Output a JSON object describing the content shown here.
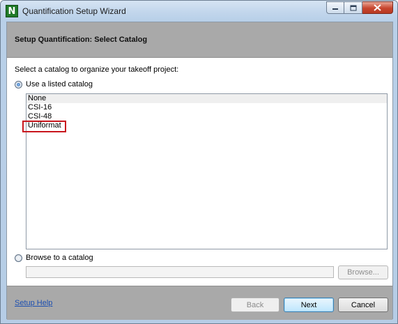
{
  "window": {
    "title": "Quantification Setup Wizard",
    "app_icon_letter": "N"
  },
  "header": {
    "title": "Setup Quantification: Select Catalog"
  },
  "body": {
    "prompt": "Select a catalog to organize your takeoff project:",
    "option_listed": "Use a listed catalog",
    "option_browse": "Browse to a catalog",
    "selected_option": "listed",
    "catalogs": [
      "None",
      "CSI-16",
      "CSI-48",
      "Uniformat"
    ],
    "highlighted_catalog": "Uniformat",
    "browse_value": "",
    "browse_button": "Browse..."
  },
  "footer": {
    "help_link": "Setup Help",
    "back": "Back",
    "next": "Next",
    "cancel": "Cancel"
  },
  "colors": {
    "header_band": "#a9a9a9",
    "highlight_border": "#c8161d",
    "link": "#1d4fb0"
  }
}
